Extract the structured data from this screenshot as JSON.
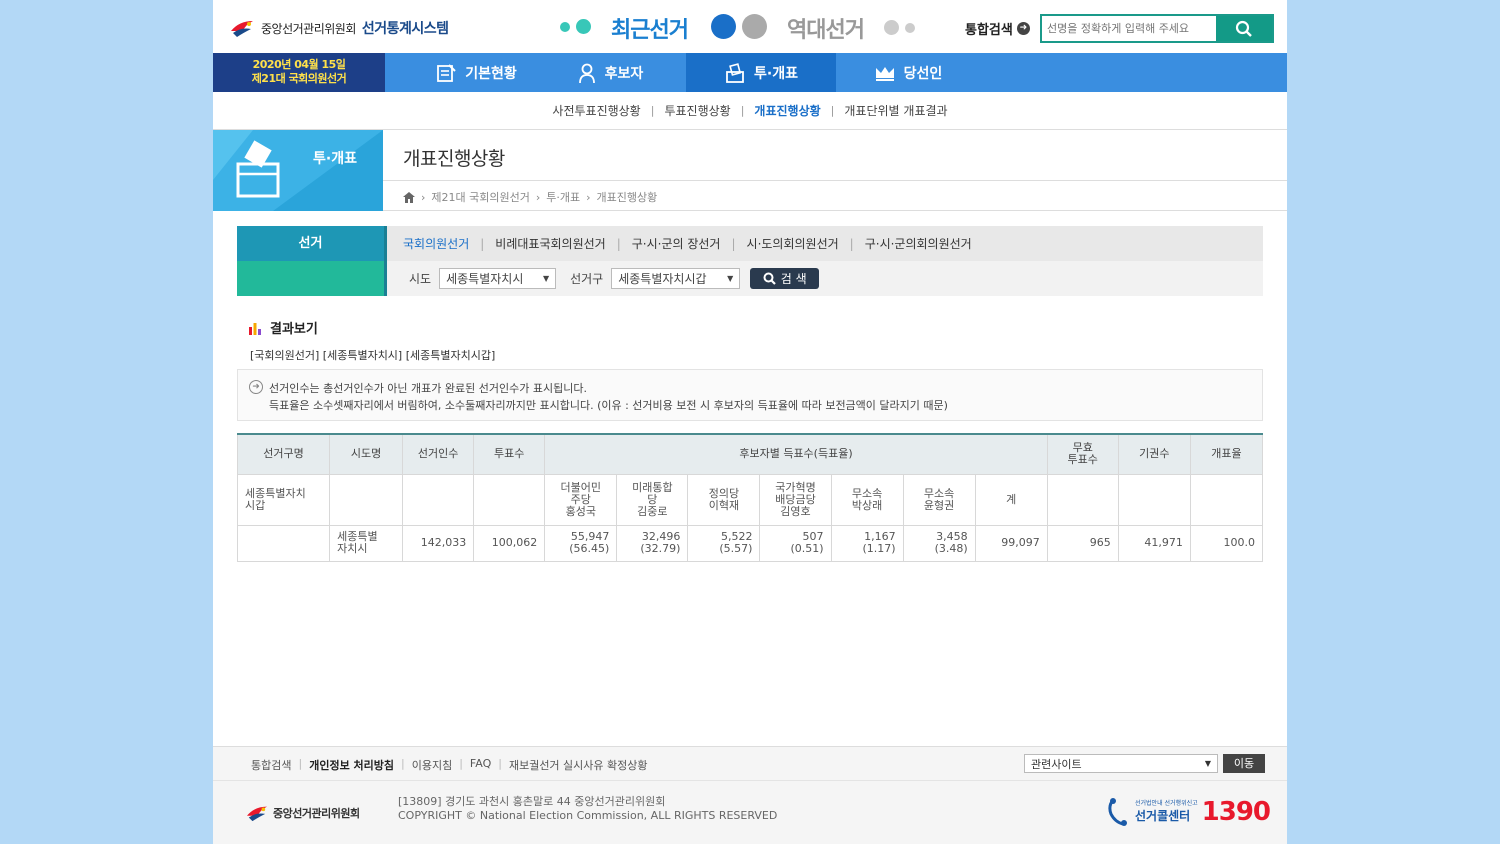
{
  "header": {
    "org_name": "중앙선거관리위원회",
    "system_name": "선거통계시스템",
    "recent_label": "최근선거",
    "past_label": "역대선거",
    "integrated_search_label": "통합검색",
    "search_placeholder": "선명을 정확하게 입력해 주세요"
  },
  "gnb": {
    "date_line1": "2020년 04월 15일",
    "date_line2": "제21대 국회의원선거",
    "items": [
      "기본현황",
      "후보자",
      "투·개표",
      "당선인"
    ]
  },
  "submenu": [
    "사전투표진행상황",
    "투표진행상황",
    "개표진행상황",
    "개표단위별 개표결과"
  ],
  "section": {
    "label": "투·개표",
    "page_title": "개표진행상황"
  },
  "breadcrumb": [
    "제21대 국회의원선거",
    "투·개표",
    "개표진행상황"
  ],
  "filter": {
    "label": "선거",
    "tabs": [
      "국회의원선거",
      "비례대표국회의원선거",
      "구·시·군의 장선거",
      "시·도의회의원선거",
      "구·시·군의회의원선거"
    ],
    "sido_label": "시도",
    "sido_value": "세종특별자치시",
    "district_label": "선거구",
    "district_value": "세종특별자치시갑",
    "search_button": "검 색"
  },
  "result": {
    "title": "결과보기",
    "path": "[국회의원선거] [세종특별자치시] [세종특별자치시갑]",
    "notice1": "선거인수는 총선거인수가 아닌 개표가 완료된 선거인수가 표시됩니다.",
    "notice2": "득표율은 소수셋째자리에서 버림하여, 소수둘째자리까지만 표시합니다. (이유 : 선거비용 보전 시 후보자의 득표율에 따라 보전금액이 달라지기 때문)"
  },
  "table": {
    "headers": [
      "선거구명",
      "시도명",
      "선거인수",
      "투표수",
      "후보자별 득표수(득표율)",
      "무효\n투표수",
      "기권수",
      "개표율"
    ],
    "district_name": "세종특별자치\n시갑",
    "candidates": [
      "더불어민\n주당\n홍성국",
      "미래통합\n당\n김중로",
      "정의당\n이혁재",
      "국가혁명\n배당금당\n김영호",
      "무소속\n박상래",
      "무소속\n윤형권",
      "계"
    ],
    "row": {
      "sido": "세종특별\n자치시",
      "electors": "142,033",
      "votes": "100,062",
      "cand_votes": [
        "55,947\n(56.45)",
        "32,496\n(32.79)",
        "5,522\n(5.57)",
        "507\n(0.51)",
        "1,167\n(1.17)",
        "3,458\n(3.48)",
        "99,097"
      ],
      "invalid": "965",
      "abstain": "41,971",
      "rate": "100.0"
    }
  },
  "footer": {
    "links": [
      "통합검색",
      "개인정보 처리방침",
      "이용지침",
      "FAQ",
      "재보궐선거 실시사유 확정상황"
    ],
    "related_label": "관련사이트",
    "go_label": "이동",
    "org": "중앙선거관리위원회",
    "address": "[13809] 경기도 과천시 홍촌말로 44 중앙선거관리위원회",
    "copyright": "COPYRIGHT © National Election Commission, ALL RIGHTS RESERVED",
    "call_small1": "선거법안내 선거행위신고",
    "call_name": "선거콜센터",
    "call_number": "1390"
  },
  "colors": {
    "brand_blue": "#3a8ee0",
    "dark_navy": "#1d3f88",
    "teal": "#1e97b5",
    "green": "#22b99a"
  },
  "icons": [
    "bird-logo-icon",
    "search-icon",
    "home-icon",
    "chart-bar-icon",
    "info-arrow-icon",
    "phone-icon"
  ]
}
